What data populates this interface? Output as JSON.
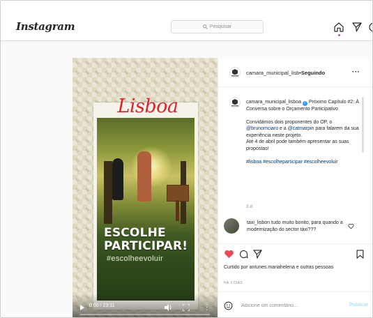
{
  "header": {
    "logo": "Instagram",
    "search_placeholder": "Pesquisar",
    "home_badge_color": "#ed4956"
  },
  "post": {
    "media": {
      "poster_title": "Lisboa",
      "poster_headline_1": "ESCOLHE",
      "poster_headline_2": "PARTICIPAR!",
      "poster_hashtag": "#escolheevoluir",
      "video_time": "0:00 / 23:11",
      "progress_fraction": 0
    },
    "author": {
      "username": "camara_municipal_lisb•",
      "separator": " • ",
      "follow_state": "Seguindo"
    },
    "caption": {
      "username": "camara_municipal_lisboa",
      "line1": " Próximo Capítulo #2: À Conversa sobre o Orçamento Participativo",
      "p2_part1": "Convidámos dois proponentes do OP, o ",
      "mention1": "@brunomciaro",
      "p2_part2": " e a ",
      "mention2": "@catmarpin",
      "p2_part3": " para falarem da sua experiência neste projeto.",
      "p2_part4": "Até 4 de abril pode também apresentar as suas propostas!",
      "hashtags": "#lisboa #escolheparticipar #escolheevoluir",
      "age": "3 d"
    },
    "comment": {
      "username": "taxi_lisbon",
      "text": " tudo muito bonito, para quando a modernização do sector táxi???"
    },
    "likes": {
      "text": "Curtido por antunes.mariahelena e outras pessoas"
    },
    "date": "HÁ 3 DIAS",
    "add_comment_placeholder": "Adicione um comentário...",
    "publish_label": "Publicar",
    "colors": {
      "heart": "#ed4956",
      "link": "#00376b",
      "publish_disabled": "#b2dffc",
      "verified": "#3897f0",
      "poster_red": "#d9262e"
    }
  }
}
